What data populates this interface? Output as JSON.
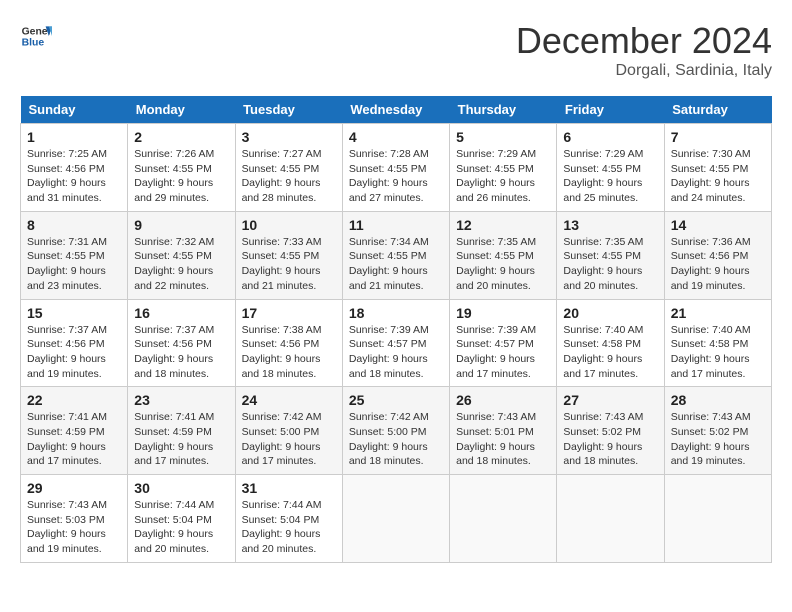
{
  "logo": {
    "line1": "General",
    "line2": "Blue"
  },
  "title": "December 2024",
  "subtitle": "Dorgali, Sardinia, Italy",
  "weekdays": [
    "Sunday",
    "Monday",
    "Tuesday",
    "Wednesday",
    "Thursday",
    "Friday",
    "Saturday"
  ],
  "weeks": [
    [
      {
        "day": "1",
        "sunrise": "7:25 AM",
        "sunset": "4:56 PM",
        "daylight": "9 hours and 31 minutes."
      },
      {
        "day": "2",
        "sunrise": "7:26 AM",
        "sunset": "4:55 PM",
        "daylight": "9 hours and 29 minutes."
      },
      {
        "day": "3",
        "sunrise": "7:27 AM",
        "sunset": "4:55 PM",
        "daylight": "9 hours and 28 minutes."
      },
      {
        "day": "4",
        "sunrise": "7:28 AM",
        "sunset": "4:55 PM",
        "daylight": "9 hours and 27 minutes."
      },
      {
        "day": "5",
        "sunrise": "7:29 AM",
        "sunset": "4:55 PM",
        "daylight": "9 hours and 26 minutes."
      },
      {
        "day": "6",
        "sunrise": "7:29 AM",
        "sunset": "4:55 PM",
        "daylight": "9 hours and 25 minutes."
      },
      {
        "day": "7",
        "sunrise": "7:30 AM",
        "sunset": "4:55 PM",
        "daylight": "9 hours and 24 minutes."
      }
    ],
    [
      {
        "day": "8",
        "sunrise": "7:31 AM",
        "sunset": "4:55 PM",
        "daylight": "9 hours and 23 minutes."
      },
      {
        "day": "9",
        "sunrise": "7:32 AM",
        "sunset": "4:55 PM",
        "daylight": "9 hours and 22 minutes."
      },
      {
        "day": "10",
        "sunrise": "7:33 AM",
        "sunset": "4:55 PM",
        "daylight": "9 hours and 21 minutes."
      },
      {
        "day": "11",
        "sunrise": "7:34 AM",
        "sunset": "4:55 PM",
        "daylight": "9 hours and 21 minutes."
      },
      {
        "day": "12",
        "sunrise": "7:35 AM",
        "sunset": "4:55 PM",
        "daylight": "9 hours and 20 minutes."
      },
      {
        "day": "13",
        "sunrise": "7:35 AM",
        "sunset": "4:55 PM",
        "daylight": "9 hours and 20 minutes."
      },
      {
        "day": "14",
        "sunrise": "7:36 AM",
        "sunset": "4:56 PM",
        "daylight": "9 hours and 19 minutes."
      }
    ],
    [
      {
        "day": "15",
        "sunrise": "7:37 AM",
        "sunset": "4:56 PM",
        "daylight": "9 hours and 19 minutes."
      },
      {
        "day": "16",
        "sunrise": "7:37 AM",
        "sunset": "4:56 PM",
        "daylight": "9 hours and 18 minutes."
      },
      {
        "day": "17",
        "sunrise": "7:38 AM",
        "sunset": "4:56 PM",
        "daylight": "9 hours and 18 minutes."
      },
      {
        "day": "18",
        "sunrise": "7:39 AM",
        "sunset": "4:57 PM",
        "daylight": "9 hours and 18 minutes."
      },
      {
        "day": "19",
        "sunrise": "7:39 AM",
        "sunset": "4:57 PM",
        "daylight": "9 hours and 17 minutes."
      },
      {
        "day": "20",
        "sunrise": "7:40 AM",
        "sunset": "4:58 PM",
        "daylight": "9 hours and 17 minutes."
      },
      {
        "day": "21",
        "sunrise": "7:40 AM",
        "sunset": "4:58 PM",
        "daylight": "9 hours and 17 minutes."
      }
    ],
    [
      {
        "day": "22",
        "sunrise": "7:41 AM",
        "sunset": "4:59 PM",
        "daylight": "9 hours and 17 minutes."
      },
      {
        "day": "23",
        "sunrise": "7:41 AM",
        "sunset": "4:59 PM",
        "daylight": "9 hours and 17 minutes."
      },
      {
        "day": "24",
        "sunrise": "7:42 AM",
        "sunset": "5:00 PM",
        "daylight": "9 hours and 17 minutes."
      },
      {
        "day": "25",
        "sunrise": "7:42 AM",
        "sunset": "5:00 PM",
        "daylight": "9 hours and 18 minutes."
      },
      {
        "day": "26",
        "sunrise": "7:43 AM",
        "sunset": "5:01 PM",
        "daylight": "9 hours and 18 minutes."
      },
      {
        "day": "27",
        "sunrise": "7:43 AM",
        "sunset": "5:02 PM",
        "daylight": "9 hours and 18 minutes."
      },
      {
        "day": "28",
        "sunrise": "7:43 AM",
        "sunset": "5:02 PM",
        "daylight": "9 hours and 19 minutes."
      }
    ],
    [
      {
        "day": "29",
        "sunrise": "7:43 AM",
        "sunset": "5:03 PM",
        "daylight": "9 hours and 19 minutes."
      },
      {
        "day": "30",
        "sunrise": "7:44 AM",
        "sunset": "5:04 PM",
        "daylight": "9 hours and 20 minutes."
      },
      {
        "day": "31",
        "sunrise": "7:44 AM",
        "sunset": "5:04 PM",
        "daylight": "9 hours and 20 minutes."
      },
      null,
      null,
      null,
      null
    ]
  ]
}
